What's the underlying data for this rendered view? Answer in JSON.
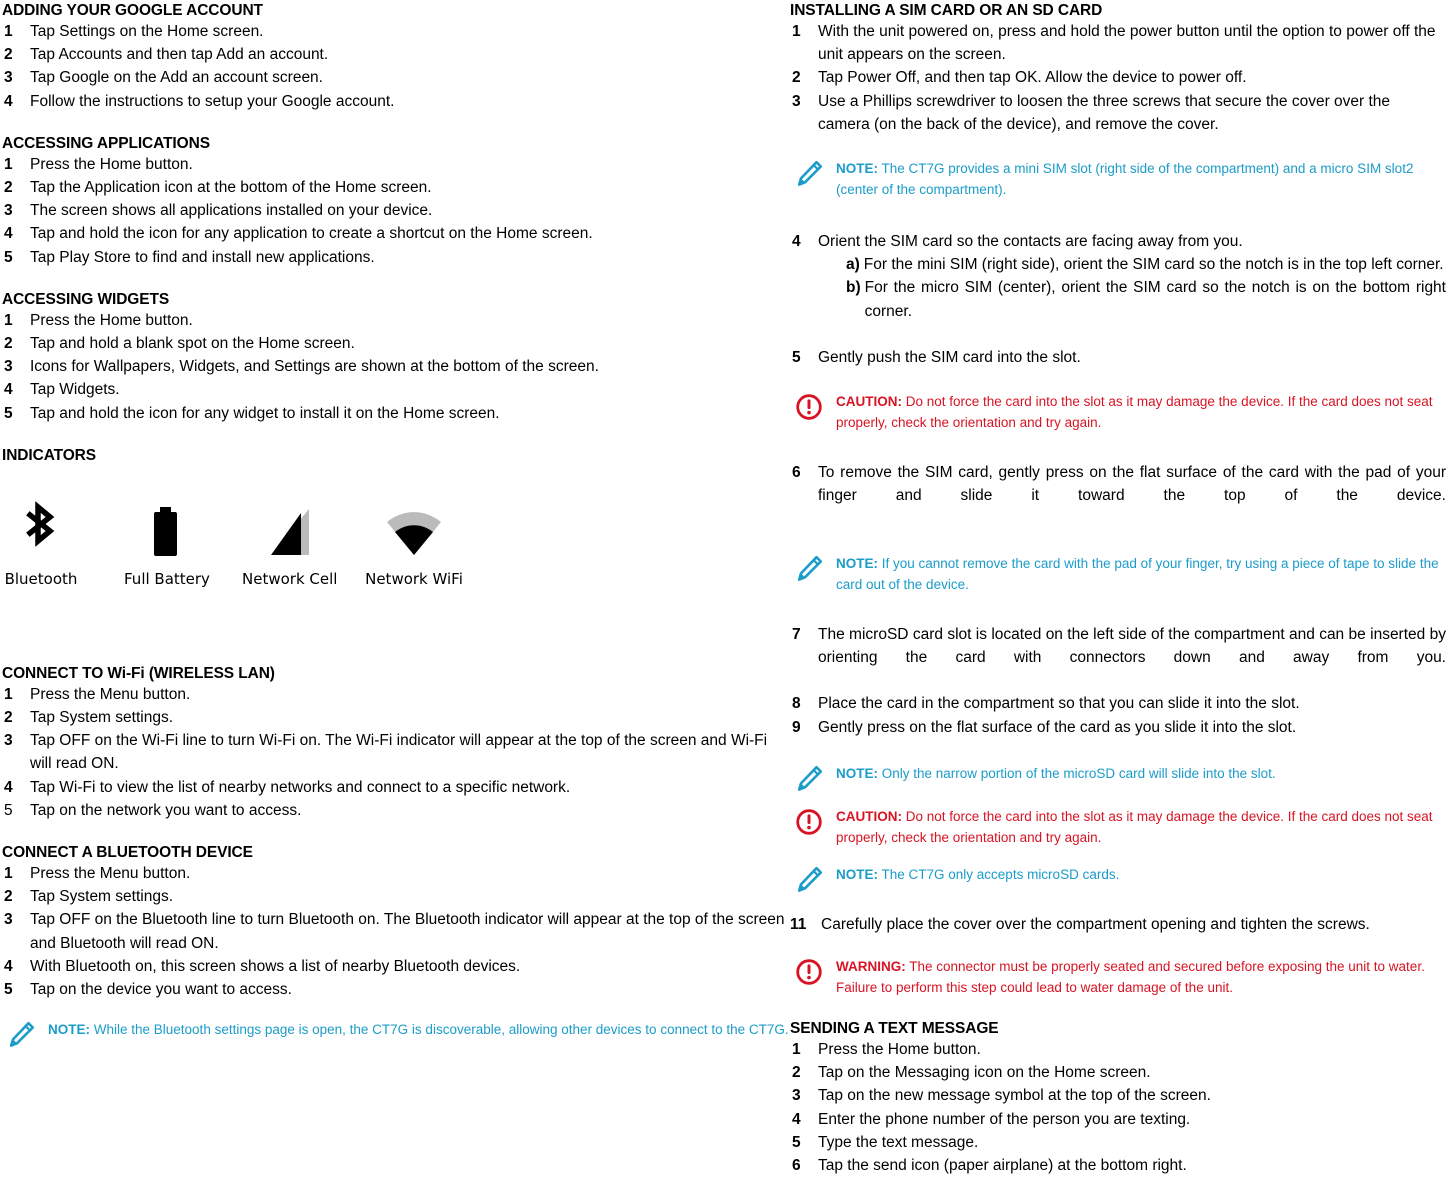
{
  "colors": {
    "note": "#1B9CC9",
    "alert": "#D81424",
    "text": "#000000",
    "icon_gray": "#BBBBBB"
  },
  "left": {
    "google_account": {
      "heading": "ADDING YOUR GOOGLE ACCOUNT",
      "steps": [
        {
          "num": "1",
          "text": "Tap Settings on the Home screen."
        },
        {
          "num": "2",
          "text": "Tap Accounts and then tap Add an account."
        },
        {
          "num": "3",
          "text": "Tap Google on the Add an account screen."
        },
        {
          "num": "4",
          "text": "Follow the instructions to setup your Google account."
        }
      ]
    },
    "accessing_applications": {
      "heading": "ACCESSING APPLICATIONS",
      "steps": [
        {
          "num": "1",
          "text": "Press the Home button."
        },
        {
          "num": "2",
          "text": "Tap the Application icon at the bottom of the Home screen."
        },
        {
          "num": "3",
          "text": "The screen shows all applications installed on your device."
        },
        {
          "num": "4",
          "text": "Tap and hold the icon for any application to create a shortcut on the Home screen."
        },
        {
          "num": "5",
          "text": "Tap Play Store to find and install new applications."
        }
      ]
    },
    "accessing_widgets": {
      "heading": "ACCESSING WIDGETS",
      "steps": [
        {
          "num": "1",
          "text": "Press the Home button."
        },
        {
          "num": "2",
          "text": "Tap and hold a blank spot on the Home screen."
        },
        {
          "num": "3",
          "text": "Icons for Wallpapers, Widgets, and Settings are shown at the bottom of the screen."
        },
        {
          "num": "4",
          "text": "Tap Widgets."
        },
        {
          "num": "5",
          "text": "Tap and hold the icon for any widget to install it on the Home screen."
        }
      ]
    },
    "indicators": {
      "heading": "INDICATORS",
      "items": [
        {
          "icon": "bluetooth-icon",
          "label": "Bluetooth"
        },
        {
          "icon": "full-battery-icon",
          "label": "Full Battery"
        },
        {
          "icon": "network-cell-icon",
          "label": "Network Cell"
        },
        {
          "icon": "network-wifi-icon",
          "label": "Network WiFi"
        }
      ]
    },
    "wifi": {
      "heading": "CONNECT TO Wi-Fi (WIRELESS LAN)",
      "steps": [
        {
          "num": "1",
          "text": "Press the Menu button."
        },
        {
          "num": "2",
          "text": "Tap System settings."
        },
        {
          "num": "3",
          "text": "Tap OFF on the Wi-Fi line to turn Wi-Fi on. The Wi-Fi indicator will appear at the top of the screen and Wi-Fi will read ON."
        },
        {
          "num": "4",
          "text": "Tap Wi-Fi to view the list of nearby networks and connect to a specific network."
        },
        {
          "num": "5",
          "text": "Tap on the network you want to access.",
          "plain_num": true
        }
      ]
    },
    "bluetooth": {
      "heading": "CONNECT A BLUETOOTH DEVICE",
      "steps": [
        {
          "num": "1",
          "text": "Press the Menu button."
        },
        {
          "num": "2",
          "text": "Tap System settings."
        },
        {
          "num": "3",
          "text": "Tap OFF on the Bluetooth line to turn Bluetooth on. The Bluetooth indicator will appear at the top of the screen and Bluetooth will read ON."
        },
        {
          "num": "4",
          "text": "With Bluetooth on, this screen shows a list of nearby Bluetooth devices."
        },
        {
          "num": "5",
          "text": "Tap on the device you want to access."
        }
      ],
      "note": {
        "type": "note",
        "icon": "pencil-icon",
        "label": "NOTE:",
        "text": " While the Bluetooth settings page is open, the CT7G is discoverable, allowing other devices to connect to the CT7G."
      }
    }
  },
  "right": {
    "sim_sd": {
      "heading": "INSTALLING A SIM CARD OR AN SD CARD",
      "steps_a": [
        {
          "num": "1",
          "text": "With the unit powered on, press and hold the power button until the option to power off the unit appears on the screen."
        },
        {
          "num": "2",
          "text": "Tap Power Off, and then tap OK. Allow the device to power off."
        },
        {
          "num": "3",
          "text": "Use a Phillips screwdriver to loosen the three screws that secure the cover over the camera (on the back of the device), and remove the cover."
        }
      ],
      "note_1": {
        "type": "note",
        "icon": "pencil-icon",
        "label": "NOTE:",
        "text": " The CT7G provides a mini SIM slot (right side of the compartment) and a micro SIM slot2 (center of the compartment)."
      },
      "step_4": {
        "num": "4",
        "text": "Orient the SIM card so the contacts are facing away from you."
      },
      "substeps": [
        {
          "letter": "a)",
          "text": "For the mini SIM (right side), orient the SIM card so the notch is in the top left corner.",
          "justify": false
        },
        {
          "letter": "b)",
          "text": "For the micro SIM (center), orient the SIM card so the notch is on the bottom right corner.",
          "justify": true
        }
      ],
      "step_5": {
        "num": "5",
        "text": "Gently push the SIM card into the slot."
      },
      "caution_1": {
        "type": "alert",
        "icon": "caution-icon",
        "label": "CAUTION:",
        "text": " Do not force the card into the slot as it may damage the device. If the card does not seat properly, check the orientation and try again."
      },
      "step_6": {
        "num": "6",
        "text": "To remove the SIM card, gently press on the flat surface of the card with the pad of your finger and slide it toward the top of the device.",
        "justify": true
      },
      "note_2": {
        "type": "note",
        "icon": "pencil-icon",
        "label": "NOTE:",
        "text": " If you cannot remove the card with the pad of your finger, try using a piece of tape to slide the card out of the device."
      },
      "steps_b": [
        {
          "num": "7",
          "text": "The microSD card slot is located on the left side of the compartment and can be inserted by orienting the card with connectors down and away from you.",
          "justify": true
        },
        {
          "num": "8",
          "text": "Place the card in the compartment so that you can slide it into the slot."
        },
        {
          "num": "9",
          "text": "Gently press on the flat surface of the card as you slide it into the slot."
        }
      ],
      "note_3": {
        "type": "note",
        "icon": "pencil-icon",
        "label": "NOTE:",
        "text": " Only the narrow portion of the microSD card will slide into the slot."
      },
      "caution_2": {
        "type": "alert",
        "icon": "caution-icon",
        "label": "CAUTION:",
        "text": " Do not force the card into the slot as it may damage the device. If the card does not seat properly, check the orientation and try again."
      },
      "note_4": {
        "type": "note",
        "icon": "pencil-icon",
        "label": "NOTE:",
        "text": " The CT7G only accepts microSD cards."
      },
      "step_11": {
        "num": "11",
        "text": "Carefully place the cover over the compartment opening and tighten the screws."
      },
      "warning": {
        "type": "alert",
        "icon": "caution-icon",
        "label": "WARNING:",
        "text": " The connector must be properly seated and secured before exposing the unit to water. Failure to perform this step could lead to water damage of the unit."
      }
    },
    "text_message": {
      "heading": "SENDING A TEXT MESSAGE",
      "steps": [
        {
          "num": "1",
          "text": "Press the Home button."
        },
        {
          "num": "2",
          "text": "Tap on the Messaging icon on the Home screen."
        },
        {
          "num": "3",
          "text": "Tap on the new message symbol at the top of the screen."
        },
        {
          "num": "4",
          "text": "Enter the phone number of the person you are texting."
        },
        {
          "num": "5",
          "text": "Type the text message."
        },
        {
          "num": "6",
          "text": "Tap the send icon (paper airplane) at the bottom right."
        }
      ]
    }
  }
}
